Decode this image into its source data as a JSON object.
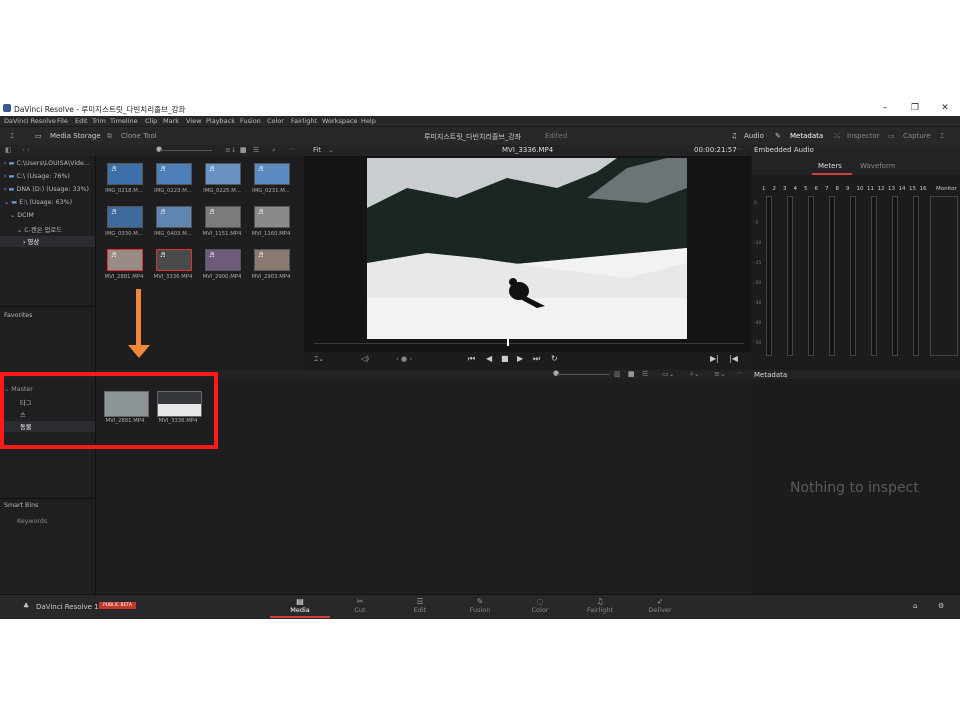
{
  "window": {
    "title": "DaVinci Resolve - 루미지스트릿_다빈치리졸브_강좌",
    "min": "–",
    "max": "❐",
    "close": "✕"
  },
  "menu": [
    "DaVinci Resolve",
    "File",
    "Edit",
    "Trim",
    "Timeline",
    "Clip",
    "Mark",
    "View",
    "Playback",
    "Fusion",
    "Color",
    "Fairlight",
    "Workspace",
    "Help"
  ],
  "toolbar": {
    "media_storage": "Media Storage",
    "clone_tool": "Clone Tool",
    "project_name": "루미지스트릿_다빈치리졸브_강좌",
    "edited": "Edited",
    "audio": "Audio",
    "metadata": "Metadata",
    "inspector": "Inspector",
    "capture": "Capture"
  },
  "viewer": {
    "fit": "Fit",
    "clip_name": "MVI_3336.MP4",
    "timecode": "00:00:21:57",
    "embedded_audio": "Embedded Audio"
  },
  "audio_panel": {
    "tab_meters": "Meters",
    "tab_waveform": "Waveform",
    "monitor": "Monitor",
    "channels": [
      "1",
      "2",
      "3",
      "4",
      "5",
      "6",
      "7",
      "8",
      "9",
      "10",
      "11",
      "12",
      "13",
      "14",
      "15",
      "16"
    ],
    "scale": [
      "0",
      "-5",
      "-10",
      "-15",
      "-20",
      "-30",
      "-40",
      "-50"
    ]
  },
  "storage": {
    "volumes": [
      "C:\\Users\\LOUISA\\Vide...",
      "C:\\ (Usage: 76%)",
      "DNA (D:) (Usage: 33%)",
      "E:\\ (Usage: 63%)",
      "DCIM",
      "C-캔온 업로드",
      "영상"
    ],
    "favorites": "Favorites"
  },
  "media_clips": [
    {
      "name": "IMG_0218.M...",
      "color": "#3d6fa8"
    },
    {
      "name": "IMG_0223.M...",
      "color": "#4f7fb8"
    },
    {
      "name": "IMG_0225.M...",
      "color": "#6a93c4"
    },
    {
      "name": "IMG_0231.M...",
      "color": "#5b8ac0"
    },
    {
      "name": "IMG_0330.M...",
      "color": "#3e6b9c"
    },
    {
      "name": "IMG_0403.M...",
      "color": "#5f86b1"
    },
    {
      "name": "MVI_1151.MP4",
      "color": "#7b7b7b"
    },
    {
      "name": "MVI_1160.MP4",
      "color": "#8a8a8a"
    },
    {
      "name": "MVI_2881.MP4",
      "color": "#9a8a86"
    },
    {
      "name": "MVI_3336.MP4",
      "color": "#4a4a4a"
    },
    {
      "name": "MVI_2900.MP4",
      "color": "#6d5b7a"
    },
    {
      "name": "MVI_2903.MP4",
      "color": "#8a7a70"
    }
  ],
  "media_pool": {
    "bins": [
      "Master",
      "타그",
      "스",
      "동물"
    ],
    "smart_bins": "Smart Bins",
    "keywords": "Keywords",
    "clips": [
      {
        "name": "MVI_2881.MP4"
      },
      {
        "name": "MVI_3336.MP4"
      }
    ]
  },
  "metadata_panel": {
    "title": "Metadata",
    "empty": "Nothing to inspect"
  },
  "pages": [
    {
      "label": "Media",
      "icon": "▤",
      "active": true
    },
    {
      "label": "Cut",
      "icon": "✂",
      "active": false
    },
    {
      "label": "Edit",
      "icon": "☰",
      "active": false
    },
    {
      "label": "Fusion",
      "icon": "✎",
      "active": false
    },
    {
      "label": "Color",
      "icon": "◌",
      "active": false
    },
    {
      "label": "Fairlight",
      "icon": "♫",
      "active": false
    },
    {
      "label": "Deliver",
      "icon": "➶",
      "active": false
    }
  ],
  "bottom": {
    "brand": "DaVinci Resolve 17",
    "beta": "PUBLIC BETA"
  }
}
